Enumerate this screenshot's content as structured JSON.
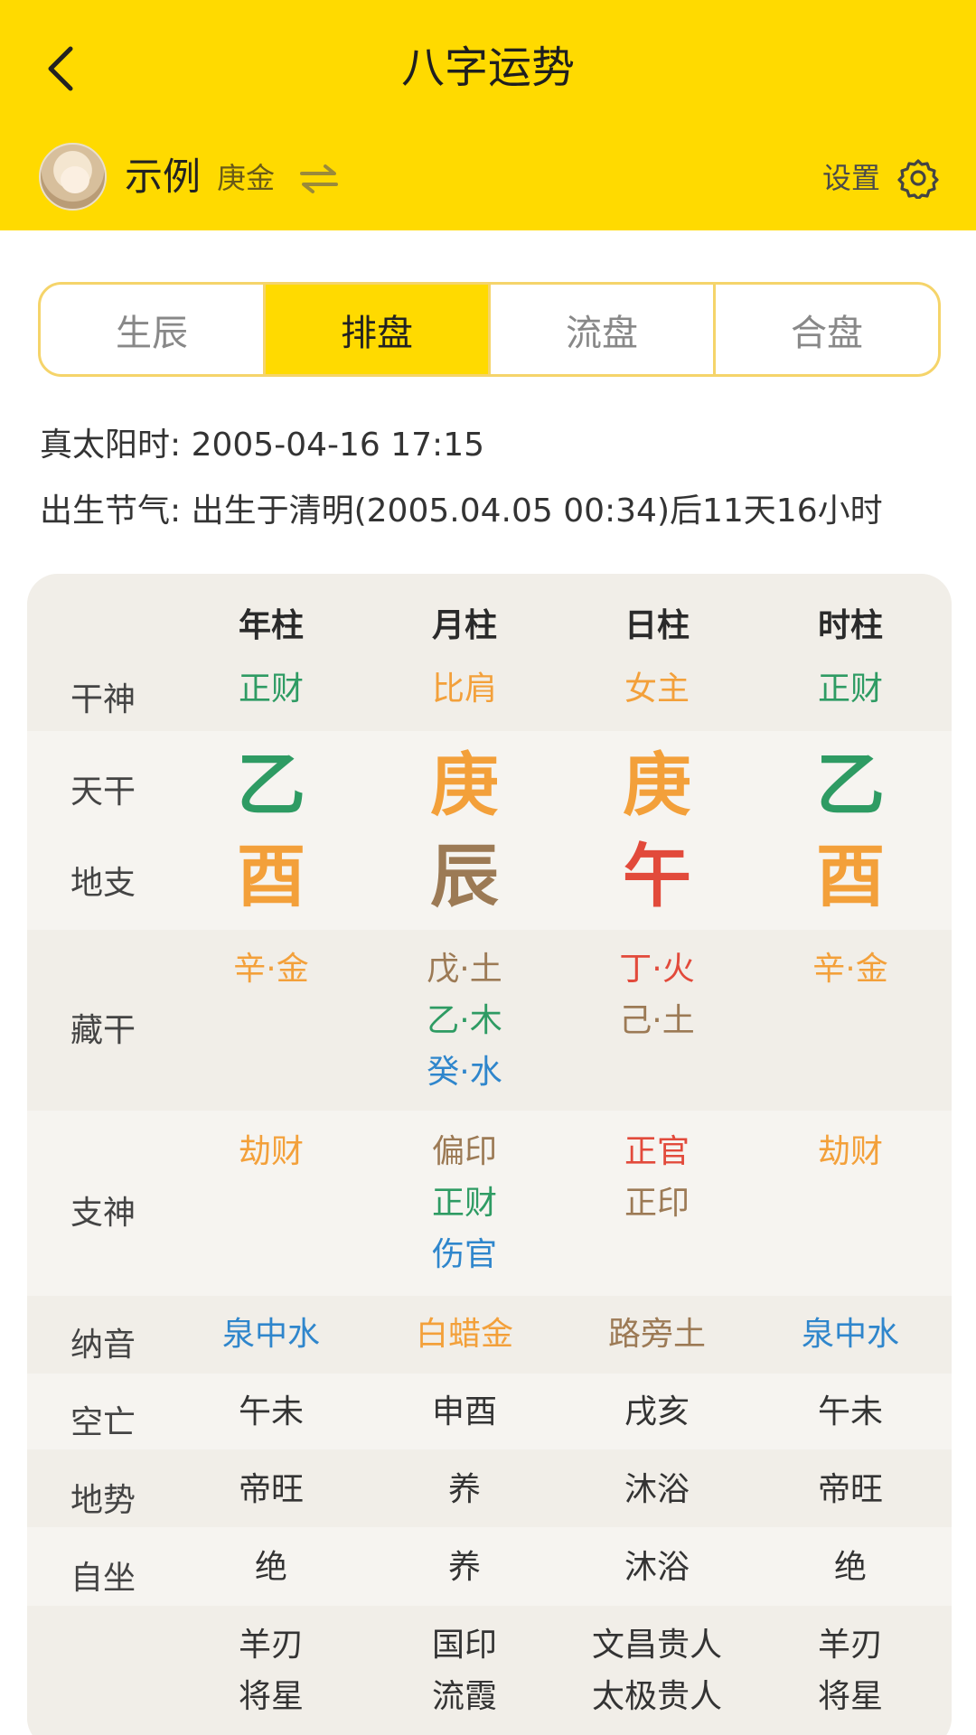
{
  "header": {
    "title": "八字运势"
  },
  "profile": {
    "name": "示例",
    "element": "庚金",
    "settings_label": "设置"
  },
  "tabs": [
    {
      "label": "生辰",
      "active": false
    },
    {
      "label": "排盘",
      "active": true
    },
    {
      "label": "流盘",
      "active": false
    },
    {
      "label": "合盘",
      "active": false
    }
  ],
  "info": {
    "solar_time_label": "真太阳时:",
    "solar_time_value": "2005-04-16 17:15",
    "jieqi_label": "出生节气:",
    "jieqi_value": "出生于清明(2005.04.05 00:34)后11天16小时"
  },
  "chart": {
    "columns": [
      "年柱",
      "月柱",
      "日柱",
      "时柱"
    ],
    "labels": {
      "ganshen": "干神",
      "tiangan": "天干",
      "dizhi": "地支",
      "canggan": "藏干",
      "zhishen": "支神",
      "nayin": "纳音",
      "kongwang": "空亡",
      "dishi": "地势",
      "zizuo": "自坐"
    },
    "ganshen": [
      "正财",
      "比肩",
      "女主",
      "正财"
    ],
    "tiangan": [
      "乙",
      "庚",
      "庚",
      "乙"
    ],
    "dizhi": [
      "酉",
      "辰",
      "午",
      "酉"
    ],
    "canggan": [
      [
        "辛·金"
      ],
      [
        "戊·土",
        "乙·木",
        "癸·水"
      ],
      [
        "丁·火",
        "己·土"
      ],
      [
        "辛·金"
      ]
    ],
    "zhishen": [
      [
        "劫财"
      ],
      [
        "偏印",
        "正财",
        "伤官"
      ],
      [
        "正官",
        "正印"
      ],
      [
        "劫财"
      ]
    ],
    "nayin": [
      "泉中水",
      "白蜡金",
      "路旁土",
      "泉中水"
    ],
    "kongwang": [
      "午未",
      "申酉",
      "戌亥",
      "午未"
    ],
    "dishi": [
      "帝旺",
      "养",
      "沐浴",
      "帝旺"
    ],
    "zizuo": [
      "绝",
      "养",
      "沐浴",
      "绝"
    ],
    "shensha": [
      [
        "羊刃",
        "将星"
      ],
      [
        "国印",
        "流霞"
      ],
      [
        "文昌贵人",
        "太极贵人"
      ],
      [
        "羊刃",
        "将星"
      ]
    ]
  },
  "colors": {
    "accent": "#FFDA00",
    "wood": "#2E9B63",
    "metal": "#F3A03A",
    "earth": "#9C7A55",
    "fire": "#E24A3B",
    "water": "#2F86CC"
  }
}
